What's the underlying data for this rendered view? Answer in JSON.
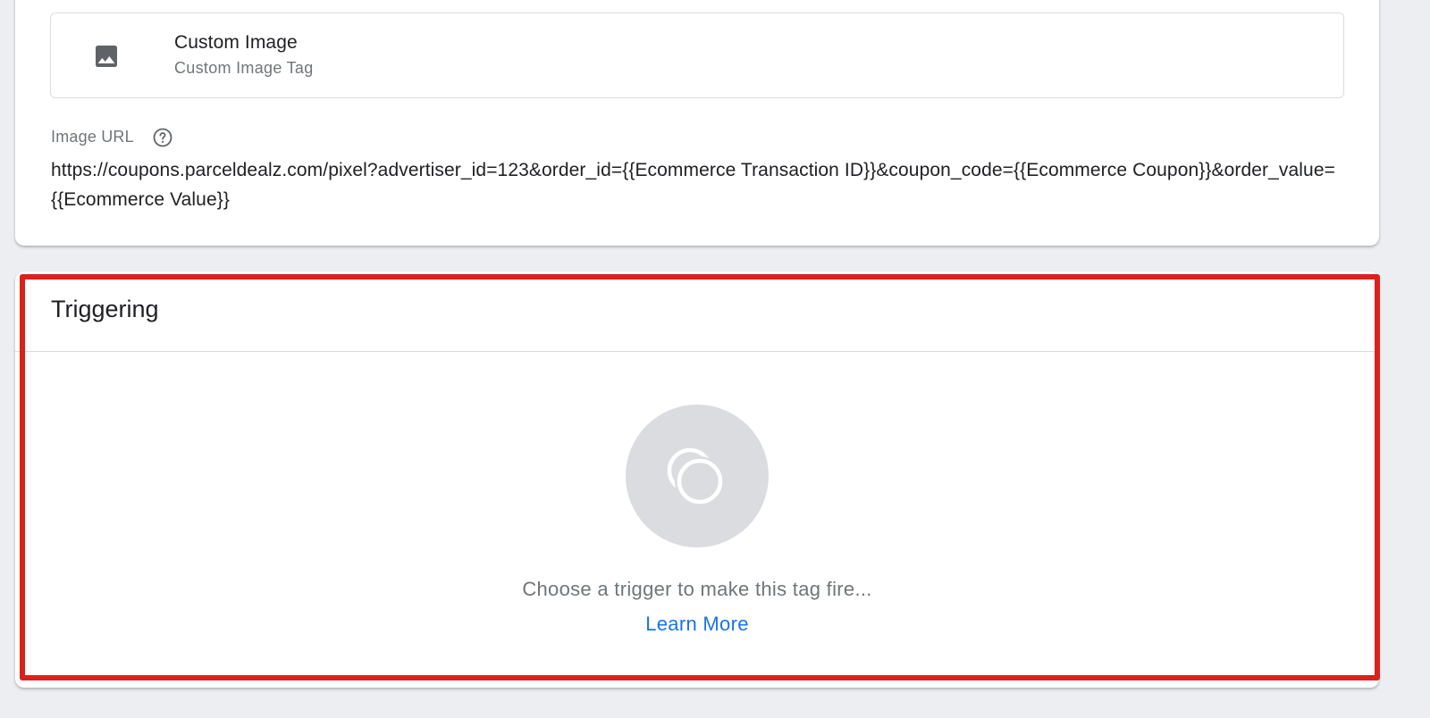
{
  "tag_configuration": {
    "tag_type": {
      "name": "Custom Image",
      "description": "Custom Image Tag",
      "icon": "image-icon"
    },
    "image_url_field": {
      "label": "Image URL",
      "help_icon": "help-circle-icon",
      "value": "https://coupons.parceldealz.com/pixel?advertiser_id=123&order_id={{Ecommerce Transaction ID}}&coupon_code={{Ecommerce Coupon}}&order_value={{Ecommerce Value}}"
    }
  },
  "triggering": {
    "title": "Triggering",
    "empty_state": {
      "icon": "trigger-circles-icon",
      "hint": "Choose a trigger to make this tag fire...",
      "learn_more_label": "Learn More"
    }
  },
  "colors": {
    "background": "#eceef1",
    "card": "#ffffff",
    "border": "#dadce0",
    "secondary_text": "#70757a",
    "link": "#1a73e8",
    "highlight": "#d9221c"
  }
}
